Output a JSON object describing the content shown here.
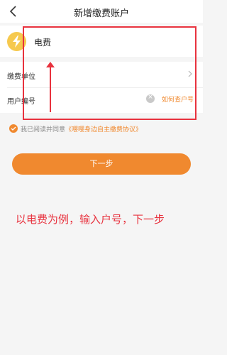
{
  "nav": {
    "title": "新增缴费账户"
  },
  "bill_type": {
    "label": "电费",
    "icon": "lightning-icon"
  },
  "form": {
    "payee_label": "缴费单位",
    "account_label": "用户编号",
    "account_value": "",
    "lookup_link": "如何查户号"
  },
  "agreement": {
    "prefix": "我已阅读并同意",
    "link": "《嘤嘤身边自主缴费协议》"
  },
  "next_button": "下一步",
  "annotation": "以电费为例，输入户号，下一步",
  "colors": {
    "accent": "#f0892f",
    "annotation": "#e8323e",
    "icon_bg": "#f6c94e"
  }
}
